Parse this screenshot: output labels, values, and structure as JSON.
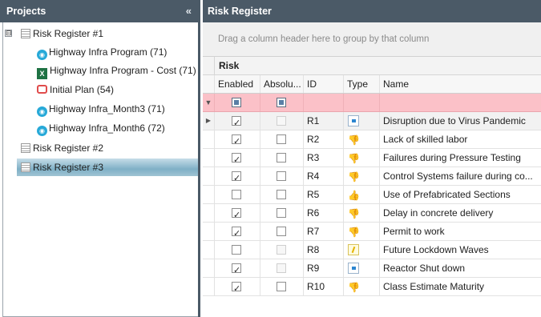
{
  "projects_panel": {
    "title": "Projects",
    "collapse_icon": "double-chevron-left-icon",
    "root": {
      "expander": "⊟",
      "label": "Risk Register #1"
    },
    "children": [
      {
        "icon": "project-icon",
        "label": "Highway Infra Program (71)"
      },
      {
        "icon": "excel-icon",
        "label": "Highway Infra Program - Cost (71)"
      },
      {
        "icon": "plan-icon",
        "label": "Initial  Plan (54)"
      },
      {
        "icon": "project-icon",
        "label": "Highway Infra_Month3 (71)"
      },
      {
        "icon": "project-icon",
        "label": "Highway Infra_Month6 (72)"
      }
    ],
    "registers": [
      {
        "label": "Risk Register #2",
        "selected": false
      },
      {
        "label": "Risk Register #3",
        "selected": true
      }
    ]
  },
  "register_panel": {
    "title": "Risk Register",
    "group_hint": "Drag a column header here to group by that column",
    "band_label": "Risk",
    "columns": [
      "Enabled",
      "Absolu...",
      "ID",
      "Type",
      "Name"
    ],
    "rows": [
      {
        "enabled": true,
        "absolute": false,
        "absolute_disabled": true,
        "id": "R1",
        "type": "square-icon",
        "name": "Disruption due to Virus Pandemic",
        "current": true
      },
      {
        "enabled": true,
        "absolute": false,
        "absolute_disabled": false,
        "id": "R2",
        "type": "thumbs-down-icon",
        "name": "Lack of skilled labor"
      },
      {
        "enabled": true,
        "absolute": false,
        "absolute_disabled": false,
        "id": "R3",
        "type": "thumbs-down-icon",
        "name": "Failures during Pressure Testing"
      },
      {
        "enabled": true,
        "absolute": false,
        "absolute_disabled": false,
        "id": "R4",
        "type": "thumbs-down-icon",
        "name": "Control Systems failure during co..."
      },
      {
        "enabled": false,
        "absolute": false,
        "absolute_disabled": false,
        "id": "R5",
        "type": "thumbs-up-icon",
        "name": "Use of Prefabricated Sections"
      },
      {
        "enabled": true,
        "absolute": false,
        "absolute_disabled": false,
        "id": "R6",
        "type": "thumbs-down-icon",
        "name": "Delay in concrete delivery"
      },
      {
        "enabled": true,
        "absolute": false,
        "absolute_disabled": false,
        "id": "R7",
        "type": "thumbs-down-icon",
        "name": "Permit to work"
      },
      {
        "enabled": false,
        "absolute": false,
        "absolute_disabled": true,
        "id": "R8",
        "type": "note-icon",
        "name": "Future Lockdown Waves"
      },
      {
        "enabled": true,
        "absolute": false,
        "absolute_disabled": true,
        "id": "R9",
        "type": "square-icon",
        "name": "Reactor Shut down"
      },
      {
        "enabled": true,
        "absolute": false,
        "absolute_disabled": false,
        "id": "R10",
        "type": "thumbs-down-icon",
        "name": "Class Estimate Maturity"
      }
    ]
  },
  "colors": {
    "header_bg": "#4b5a67",
    "filter_row_bg": "#fbc1c8",
    "selection_bg": "#7fb0c6"
  }
}
